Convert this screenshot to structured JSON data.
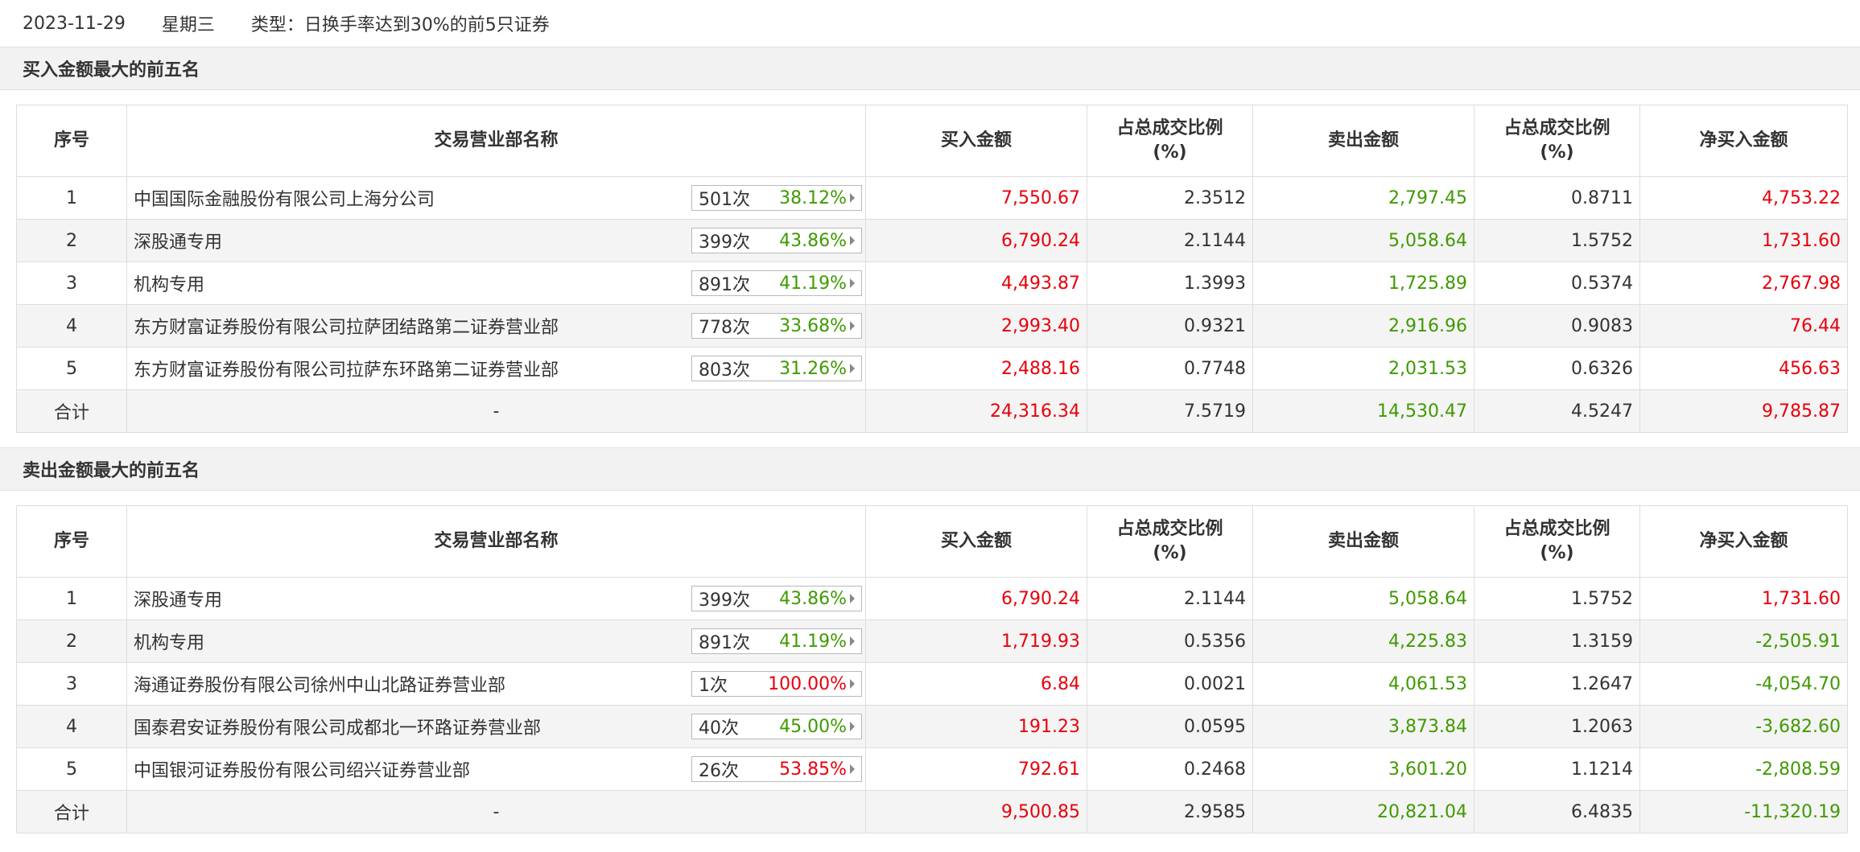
{
  "header": {
    "date": "2023-11-29",
    "weekday": "星期三",
    "type": "类型：日换手率达到30%的前5只证券"
  },
  "columns": {
    "idx": "序号",
    "name": "交易营业部名称",
    "buy": "买入金额",
    "buy_ratio": "占总成交比例\n(%)",
    "sell": "卖出金额",
    "sell_ratio": "占总成交比例\n(%)",
    "net": "净买入金额"
  },
  "colors": {
    "up": "#e8000b",
    "down": "#3f9a00"
  },
  "buy_section": {
    "title": "买入金额最大的前五名",
    "rows": [
      {
        "idx": "1",
        "name": "中国国际金融股份有限公司上海分公司",
        "count": "501次",
        "rate": "38.12%",
        "rate_color": "green",
        "buy": "7,550.67",
        "buy_ratio": "2.3512",
        "sell": "2,797.45",
        "sell_ratio": "0.8711",
        "net": "4,753.22",
        "net_color": "red"
      },
      {
        "idx": "2",
        "name": "深股通专用",
        "count": "399次",
        "rate": "43.86%",
        "rate_color": "green",
        "buy": "6,790.24",
        "buy_ratio": "2.1144",
        "sell": "5,058.64",
        "sell_ratio": "1.5752",
        "net": "1,731.60",
        "net_color": "red"
      },
      {
        "idx": "3",
        "name": "机构专用",
        "count": "891次",
        "rate": "41.19%",
        "rate_color": "green",
        "buy": "4,493.87",
        "buy_ratio": "1.3993",
        "sell": "1,725.89",
        "sell_ratio": "0.5374",
        "net": "2,767.98",
        "net_color": "red"
      },
      {
        "idx": "4",
        "name": "东方财富证券股份有限公司拉萨团结路第二证券营业部",
        "count": "778次",
        "rate": "33.68%",
        "rate_color": "green",
        "buy": "2,993.40",
        "buy_ratio": "0.9321",
        "sell": "2,916.96",
        "sell_ratio": "0.9083",
        "net": "76.44",
        "net_color": "red"
      },
      {
        "idx": "5",
        "name": "东方财富证券股份有限公司拉萨东环路第二证券营业部",
        "count": "803次",
        "rate": "31.26%",
        "rate_color": "green",
        "buy": "2,488.16",
        "buy_ratio": "0.7748",
        "sell": "2,031.53",
        "sell_ratio": "0.6326",
        "net": "456.63",
        "net_color": "red"
      }
    ],
    "total": {
      "label": "合计",
      "name": "-",
      "buy": "24,316.34",
      "buy_ratio": "7.5719",
      "sell": "14,530.47",
      "sell_ratio": "4.5247",
      "net": "9,785.87",
      "net_color": "red"
    }
  },
  "sell_section": {
    "title": "卖出金额最大的前五名",
    "rows": [
      {
        "idx": "1",
        "name": "深股通专用",
        "count": "399次",
        "rate": "43.86%",
        "rate_color": "green",
        "buy": "6,790.24",
        "buy_ratio": "2.1144",
        "sell": "5,058.64",
        "sell_ratio": "1.5752",
        "net": "1,731.60",
        "net_color": "red"
      },
      {
        "idx": "2",
        "name": "机构专用",
        "count": "891次",
        "rate": "41.19%",
        "rate_color": "green",
        "buy": "1,719.93",
        "buy_ratio": "0.5356",
        "sell": "4,225.83",
        "sell_ratio": "1.3159",
        "net": "-2,505.91",
        "net_color": "green"
      },
      {
        "idx": "3",
        "name": "海通证券股份有限公司徐州中山北路证券营业部",
        "count": "1次",
        "rate": "100.00%",
        "rate_color": "red",
        "buy": "6.84",
        "buy_ratio": "0.0021",
        "sell": "4,061.53",
        "sell_ratio": "1.2647",
        "net": "-4,054.70",
        "net_color": "green"
      },
      {
        "idx": "4",
        "name": "国泰君安证券股份有限公司成都北一环路证券营业部",
        "count": "40次",
        "rate": "45.00%",
        "rate_color": "green",
        "buy": "191.23",
        "buy_ratio": "0.0595",
        "sell": "3,873.84",
        "sell_ratio": "1.2063",
        "net": "-3,682.60",
        "net_color": "green"
      },
      {
        "idx": "5",
        "name": "中国银河证券股份有限公司绍兴证券营业部",
        "count": "26次",
        "rate": "53.85%",
        "rate_color": "red",
        "buy": "792.61",
        "buy_ratio": "0.2468",
        "sell": "3,601.20",
        "sell_ratio": "1.1214",
        "net": "-2,808.59",
        "net_color": "green"
      }
    ],
    "total": {
      "label": "合计",
      "name": "-",
      "buy": "9,500.85",
      "buy_ratio": "2.9585",
      "sell": "20,821.04",
      "sell_ratio": "6.4835",
      "net": "-11,320.19",
      "net_color": "green"
    }
  }
}
